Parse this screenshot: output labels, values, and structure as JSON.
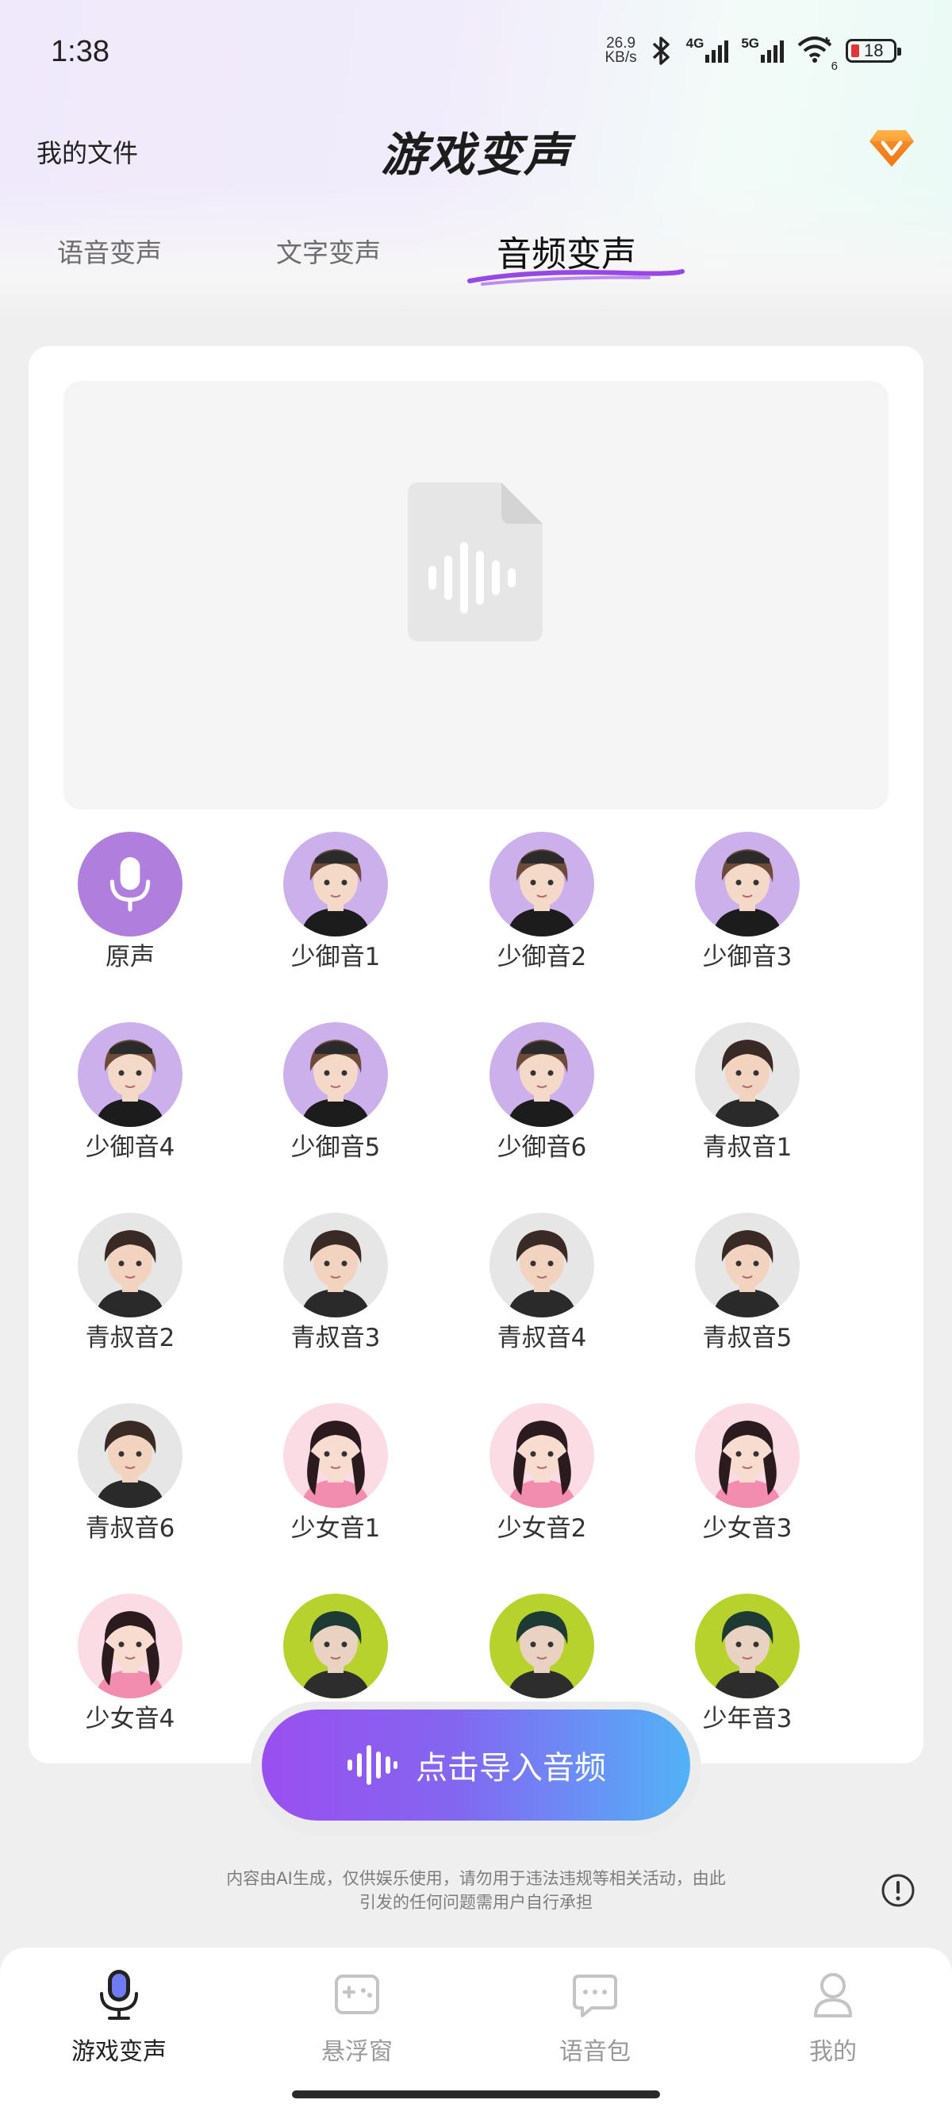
{
  "status_bar": {
    "time": "1:38",
    "net_speed_value": "26.9",
    "net_speed_unit": "KB/s",
    "signal_1_label": "4G",
    "signal_2_label": "5G",
    "wifi_sub": "6",
    "battery": "18"
  },
  "header": {
    "left_link": "我的文件",
    "title": "游戏变声",
    "vip_icon": "diamond-vip-icon"
  },
  "tabs": [
    {
      "label": "语音变声",
      "active": false
    },
    {
      "label": "文字变声",
      "active": false
    },
    {
      "label": "音频变声",
      "active": true
    }
  ],
  "preview": {
    "icon": "audio-file-icon"
  },
  "voices": [
    {
      "label": "原声",
      "type": "mic"
    },
    {
      "label": "少御音1",
      "type": "purple"
    },
    {
      "label": "少御音2",
      "type": "purple"
    },
    {
      "label": "少御音3",
      "type": "purple"
    },
    {
      "label": "少御音4",
      "type": "purple"
    },
    {
      "label": "少御音5",
      "type": "purple"
    },
    {
      "label": "少御音6",
      "type": "purple"
    },
    {
      "label": "青叔音1",
      "type": "gray"
    },
    {
      "label": "青叔音2",
      "type": "gray"
    },
    {
      "label": "青叔音3",
      "type": "gray"
    },
    {
      "label": "青叔音4",
      "type": "gray"
    },
    {
      "label": "青叔音5",
      "type": "gray"
    },
    {
      "label": "青叔音6",
      "type": "gray"
    },
    {
      "label": "少女音1",
      "type": "pink"
    },
    {
      "label": "少女音2",
      "type": "pink"
    },
    {
      "label": "少女音3",
      "type": "pink"
    },
    {
      "label": "少女音4",
      "type": "pink"
    },
    {
      "label": "",
      "type": "lime"
    },
    {
      "label": "",
      "type": "lime"
    },
    {
      "label": "少年音3",
      "type": "lime"
    }
  ],
  "import_button": {
    "label": "点击导入音频"
  },
  "disclaimer": {
    "line1": "内容由AI生成，仅供娱乐使用，请勿用于违法违规等相关活动，由此",
    "line2": "引发的任何问题需用户自行承担"
  },
  "bottom_nav": [
    {
      "label": "游戏变声",
      "icon": "microphone-icon",
      "active": true
    },
    {
      "label": "悬浮窗",
      "icon": "gamepad-icon",
      "active": false
    },
    {
      "label": "语音包",
      "icon": "chat-bubble-icon",
      "active": false
    },
    {
      "label": "我的",
      "icon": "person-icon",
      "active": false
    }
  ],
  "colors": {
    "accent_purple": "#9a4ff0",
    "accent_blue": "#52b2f6",
    "mic_avatar": "#b07fdd"
  }
}
